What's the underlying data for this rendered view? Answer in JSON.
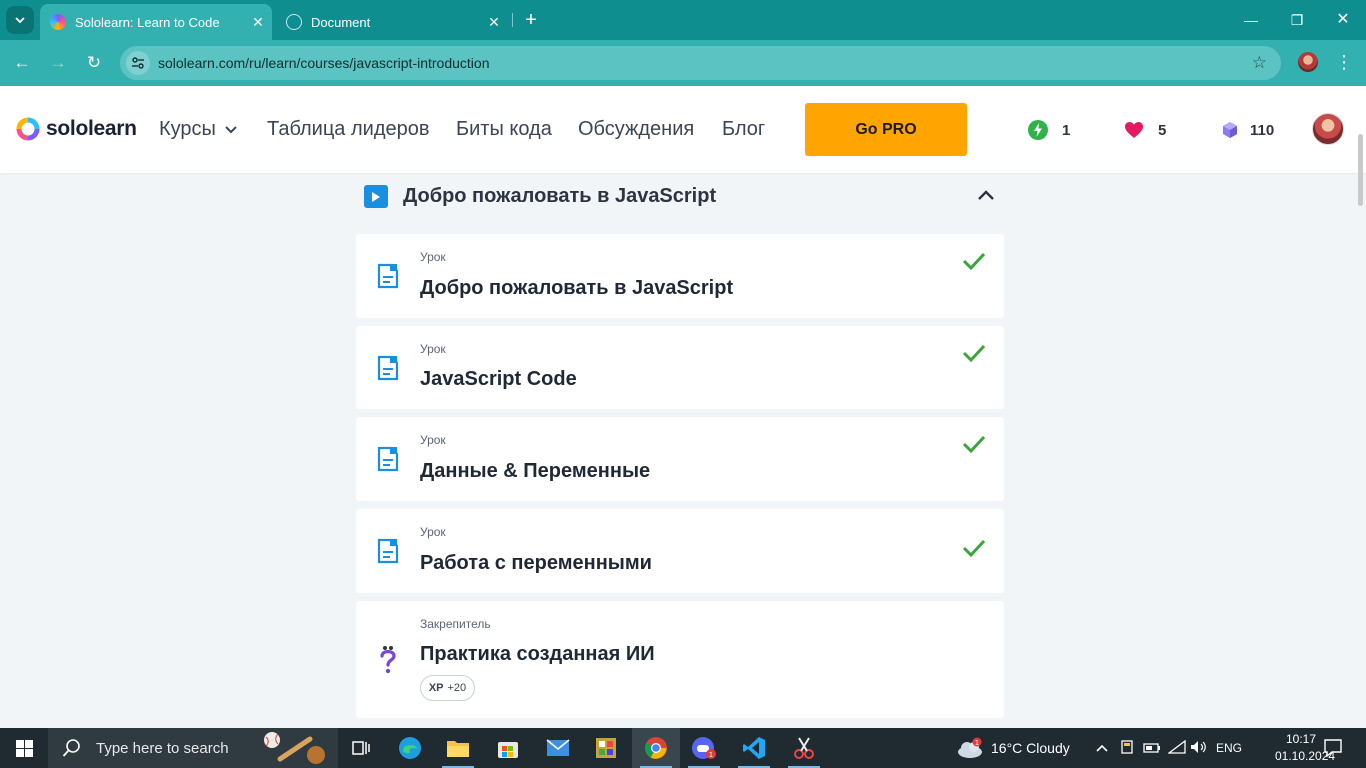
{
  "browser": {
    "tabs": [
      {
        "title": "Sololearn: Learn to Code",
        "active": true
      },
      {
        "title": "Document",
        "active": false
      }
    ],
    "address": "sololearn.com/ru/learn/courses/javascript-introduction"
  },
  "header": {
    "logo_text": "sololearn",
    "nav": {
      "courses": "Курсы",
      "leaderboard": "Таблица лидеров",
      "code_bits": "Биты кода",
      "discussions": "Обсуждения",
      "blog": "Блог"
    },
    "gopro": "Go PRO",
    "stats": {
      "streak": "1",
      "hearts": "5",
      "gems": "110"
    }
  },
  "module": {
    "title": "Добро пожаловать в JavaScript"
  },
  "lessons": [
    {
      "kind": "Урок",
      "title": "Добро пожаловать в JavaScript",
      "completed": true
    },
    {
      "kind": "Урок",
      "title": "JavaScript Code",
      "completed": true
    },
    {
      "kind": "Урок",
      "title": "Данные & Переменные",
      "completed": true
    },
    {
      "kind": "Урок",
      "title": "Работа с переменными",
      "completed": true
    }
  ],
  "practice": {
    "kind": "Закрепитель",
    "title": "Практика созданная ИИ",
    "xp_label": "XP",
    "xp_value": "+20"
  },
  "taskbar": {
    "search_placeholder": "Type here to search",
    "weather": "16°C  Cloudy",
    "lang": "ENG",
    "time": "10:17",
    "date": "01.10.2024"
  },
  "colors": {
    "accent": "#1a8fdf",
    "check": "#3aa53a",
    "gopro": "#ffa400",
    "chrome": "#33b1b1"
  }
}
